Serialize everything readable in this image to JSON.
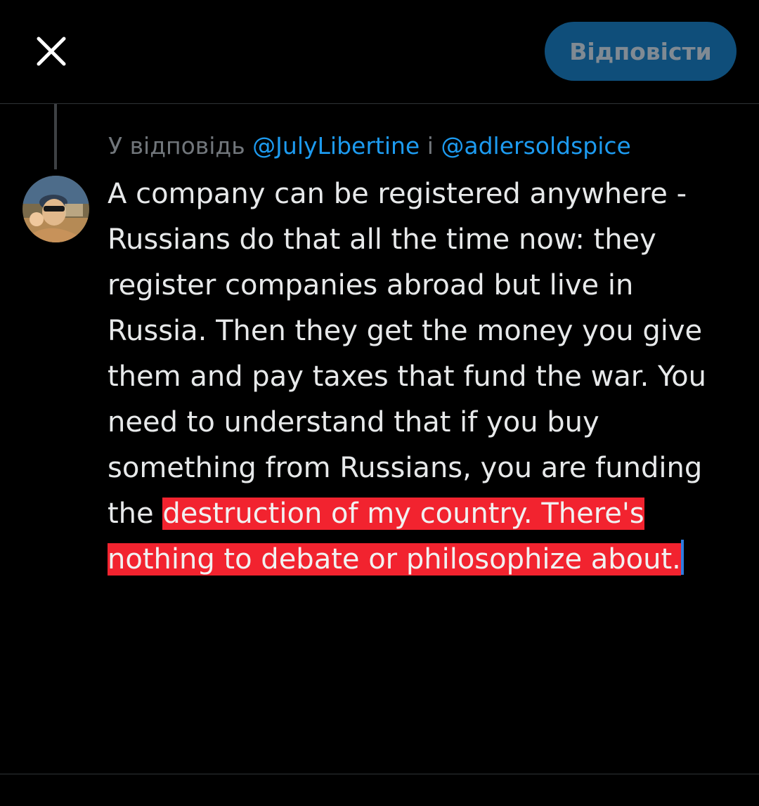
{
  "header": {
    "close_icon": "close-icon",
    "reply_button_label": "Відповісти",
    "reply_button_color": "#0f4e7a"
  },
  "reply_context": {
    "prefix": "У відповідь ",
    "mention_1": "@JulyLibertine",
    "joiner": " і ",
    "mention_2": "@adlersoldspice"
  },
  "composer": {
    "avatar": "user-avatar",
    "text_plain": "A company can be registered anywhere - Russians do that all the time now: they register companies abroad but live in Russia. Then they get the money you give them and pay taxes that fund the war. You need to understand that if you buy something from Russians, you are funding the ",
    "text_selected": "destruction of my country. There's nothing to debate or philosophize about.",
    "selection_color": "#f2232f",
    "mention_color": "#1d9bf0"
  }
}
